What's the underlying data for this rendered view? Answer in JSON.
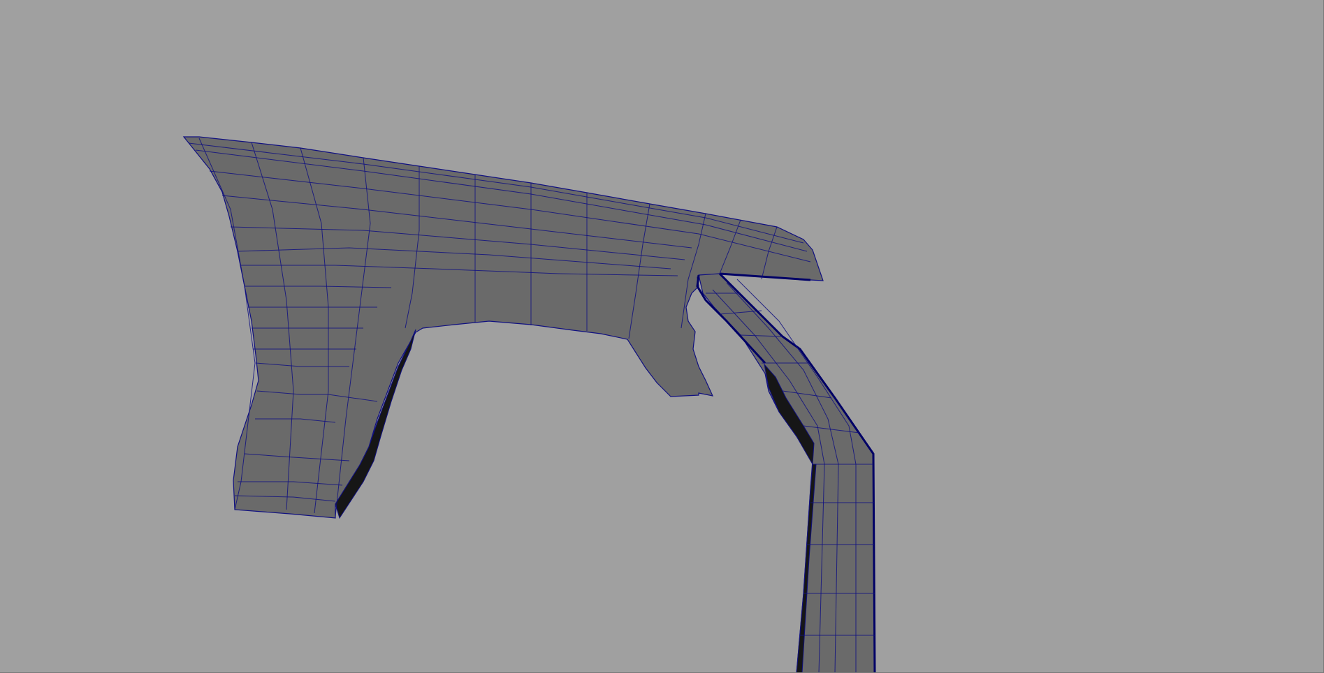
{
  "viewport": {
    "background": "#a0a0a0",
    "mesh_fill": "#6a6a6a",
    "mesh_fill_dark": "#161616",
    "wireframe_color": "#101080",
    "selection_edge_color": "#000066"
  }
}
